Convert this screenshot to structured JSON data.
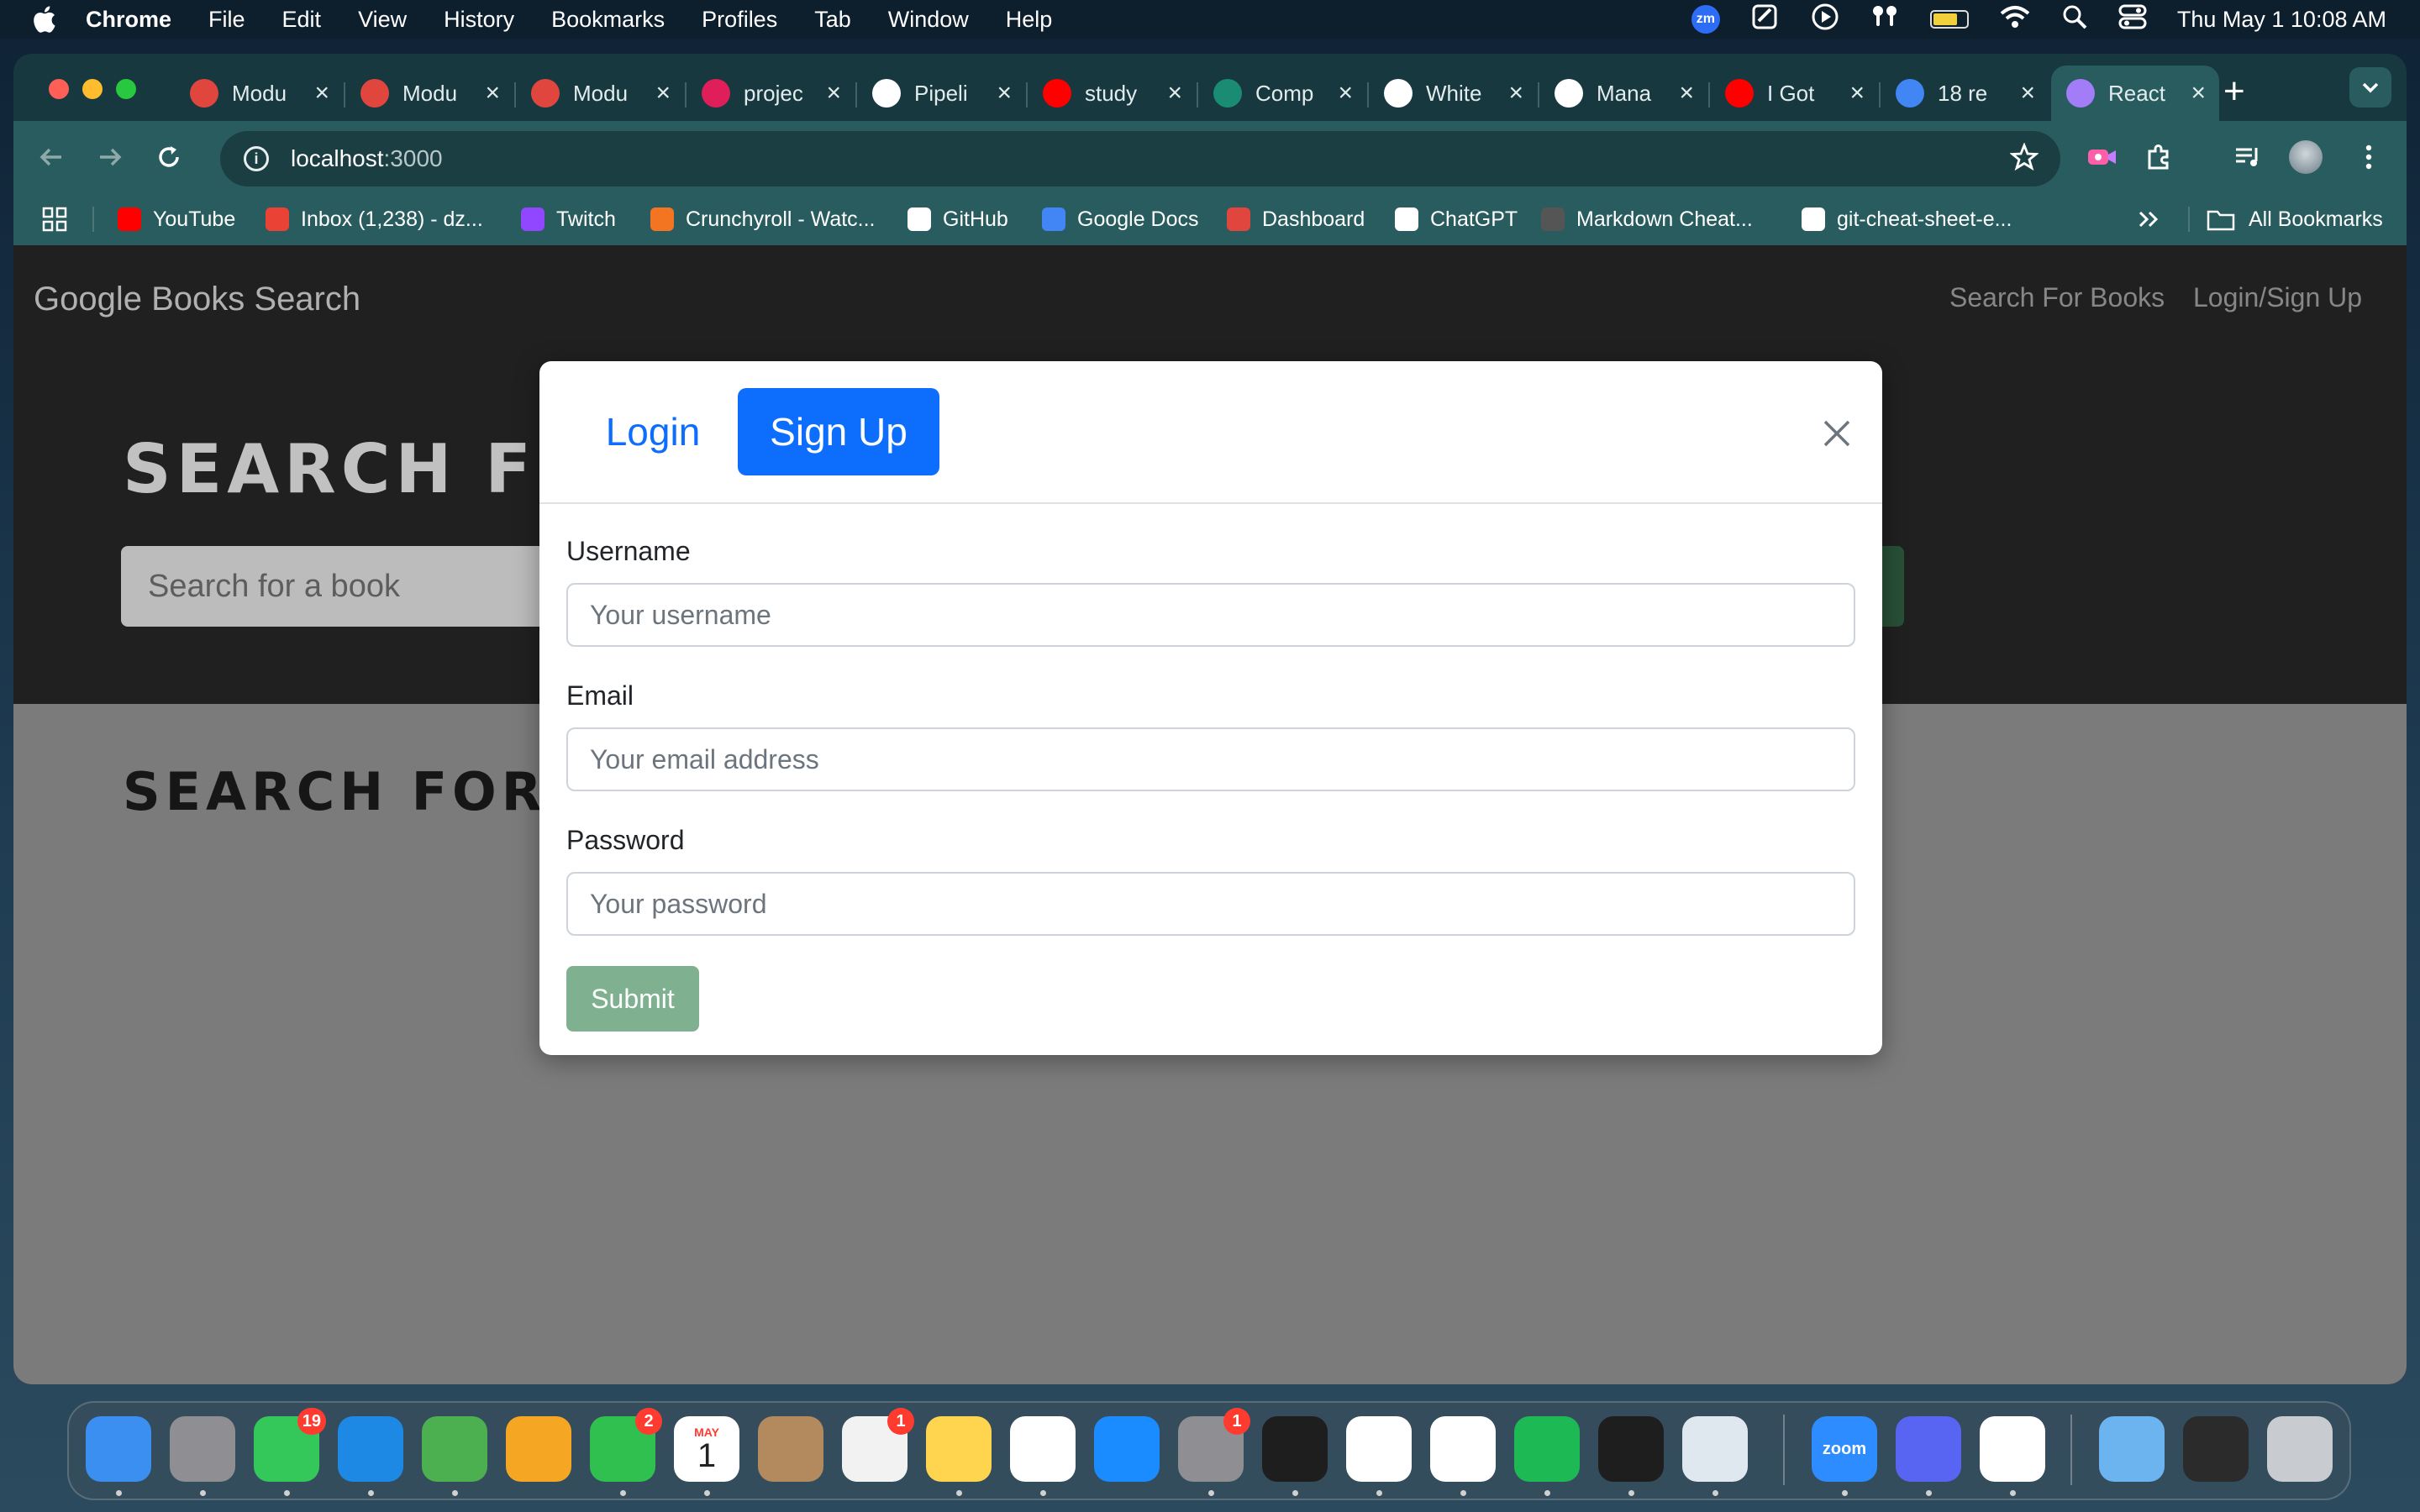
{
  "menubar": {
    "app_name": "Chrome",
    "items": [
      "File",
      "Edit",
      "View",
      "History",
      "Bookmarks",
      "Profiles",
      "Tab",
      "Window",
      "Help"
    ],
    "zoom_badge": "zm",
    "clock": "Thu May 1  10:08 AM"
  },
  "browser": {
    "tabs": [
      {
        "title": "Modu",
        "icon": "grid-logo-icon",
        "color": "#e0463e"
      },
      {
        "title": "Modu",
        "icon": "grid-logo-icon",
        "color": "#e0463e"
      },
      {
        "title": "Modu",
        "icon": "grid-logo-icon",
        "color": "#e0463e"
      },
      {
        "title": "projec",
        "icon": "slack-icon",
        "color": "#e01e5a"
      },
      {
        "title": "Pipeli",
        "icon": "pipeline-icon",
        "color": "#ffffff"
      },
      {
        "title": "study",
        "icon": "youtube-icon",
        "color": "#ff0000"
      },
      {
        "title": "Comp",
        "icon": "loading-icon",
        "color": "#1a8c74"
      },
      {
        "title": "White",
        "icon": "openai-icon",
        "color": "#ffffff"
      },
      {
        "title": "Mana",
        "icon": "github-icon",
        "color": "#ffffff"
      },
      {
        "title": "I Got",
        "icon": "youtube-icon",
        "color": "#ff0000"
      },
      {
        "title": "18 re",
        "icon": "google-docs-icon",
        "color": "#4285f4"
      },
      {
        "title": "React",
        "icon": "vite-icon",
        "color": "#a37cf7",
        "active": true
      }
    ],
    "address": {
      "host": "localhost",
      "port": ":3000"
    },
    "bookmarks": [
      {
        "label": "YouTube",
        "icon": "youtube-icon",
        "color": "#ff0000"
      },
      {
        "label": "Inbox (1,238) - dz...",
        "icon": "gmail-icon",
        "color": "#ea4335"
      },
      {
        "label": "Twitch",
        "icon": "twitch-icon",
        "color": "#9146ff"
      },
      {
        "label": "Crunchyroll - Watc...",
        "icon": "crunchyroll-icon",
        "color": "#f47521"
      },
      {
        "label": "GitHub",
        "icon": "github-icon",
        "color": "#ffffff"
      },
      {
        "label": "Google Docs",
        "icon": "google-docs-icon",
        "color": "#4285f4"
      },
      {
        "label": "Dashboard",
        "icon": "grid-logo-icon",
        "color": "#e0463e"
      },
      {
        "label": "ChatGPT",
        "icon": "openai-icon",
        "color": "#ffffff"
      },
      {
        "label": "Markdown Cheat...",
        "icon": "markdown-icon",
        "color": "#555555"
      },
      {
        "label": "git-cheat-sheet-e...",
        "icon": "github-icon",
        "color": "#ffffff"
      }
    ],
    "all_bookmarks": "All Bookmarks"
  },
  "site": {
    "brand": "Google Books Search",
    "nav_links": [
      "Search For Books",
      "Login/Sign Up"
    ],
    "hero_title": "SEARCH   FOR   BOOKS!",
    "search_placeholder": "Search for a book",
    "results_title": "SEARCH   FOR   A   BOOK   TO   BEGIN"
  },
  "modal": {
    "tabs": {
      "login": "Login",
      "signup": "Sign Up",
      "active": "signup"
    },
    "fields": [
      {
        "label": "Username",
        "placeholder": "Your username",
        "value": ""
      },
      {
        "label": "Email",
        "placeholder": "Your email address",
        "value": ""
      },
      {
        "label": "Password",
        "placeholder": "Your password",
        "value": ""
      }
    ],
    "submit_label": "Submit",
    "accent_color": "#0d6efd"
  },
  "dock": {
    "apps": [
      {
        "name": "Finder",
        "icon": "finder-icon",
        "color": "#3b8ff0"
      },
      {
        "name": "Launchpad",
        "icon": "launchpad-icon",
        "color": "#8e8e93"
      },
      {
        "name": "Messages",
        "icon": "messages-icon",
        "color": "#34c759",
        "badge": "19"
      },
      {
        "name": "Mail",
        "icon": "mail-icon",
        "color": "#1e88e5"
      },
      {
        "name": "Maps",
        "icon": "maps-icon",
        "color": "#4caf50"
      },
      {
        "name": "Photos",
        "icon": "photos-icon",
        "color": "#f5a623"
      },
      {
        "name": "FaceTime",
        "icon": "facetime-icon",
        "color": "#30c04f",
        "badge": "2"
      },
      {
        "name": "Calendar",
        "icon": "calendar-icon",
        "color": "#ffffff",
        "month": "MAY",
        "day": "1"
      },
      {
        "name": "Contacts",
        "icon": "contacts-icon",
        "color": "#b28a5e"
      },
      {
        "name": "Reminders",
        "icon": "reminders-icon",
        "color": "#f2f2f2",
        "badge": "1"
      },
      {
        "name": "Notes",
        "icon": "notes-icon",
        "color": "#ffd54f"
      },
      {
        "name": "Freeform",
        "icon": "freeform-icon",
        "color": "#ffffff"
      },
      {
        "name": "App Store",
        "icon": "app-store-icon",
        "color": "#1a8cff"
      },
      {
        "name": "System Settings",
        "icon": "settings-icon",
        "color": "#8e8e93",
        "badge": "1"
      },
      {
        "name": "Terminal",
        "icon": "terminal-icon",
        "color": "#1e1e1e"
      },
      {
        "name": "VS Code",
        "icon": "vscode-icon",
        "color": "#ffffff"
      },
      {
        "name": "Chrome",
        "icon": "chrome-icon",
        "color": "#ffffff"
      },
      {
        "name": "Spotify",
        "icon": "spotify-icon",
        "color": "#1db954"
      },
      {
        "name": "Activity Monitor",
        "icon": "activity-monitor-icon",
        "color": "#1e1e1e"
      },
      {
        "name": "PostgreSQL",
        "icon": "postgres-icon",
        "color": "#dfe7ef"
      },
      {
        "name": "Zoom",
        "icon": "zoom-icon",
        "color": "#2d8cff",
        "text": "zoom"
      },
      {
        "name": "Discord",
        "icon": "discord-icon",
        "color": "#5865f2"
      },
      {
        "name": "MongoDB Compass",
        "icon": "mongodb-icon",
        "color": "#ffffff"
      },
      {
        "name": "Folder",
        "icon": "folder-icon",
        "color": "#6cb4f0"
      },
      {
        "name": "Recent",
        "icon": "window-preview-icon",
        "color": "#2b2b2b"
      },
      {
        "name": "Trash",
        "icon": "trash-icon",
        "color": "#c8ccd0"
      }
    ]
  }
}
